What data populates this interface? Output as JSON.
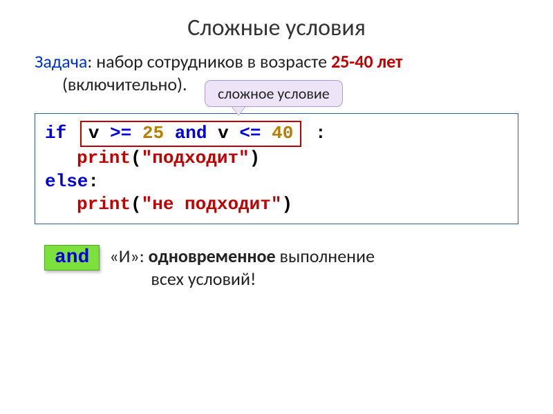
{
  "title": "Сложные условия",
  "task": {
    "label": "Задача",
    "text1": ": набор сотрудников в возрасте ",
    "bold": "25-40 лет",
    "text2": "(включительно)."
  },
  "callout": {
    "text": "сложное условие"
  },
  "code": {
    "if": "if",
    "cond_pre": "v ",
    "ge": ">=",
    "n25": " 25 ",
    "and": "and",
    "cond_mid": " v ",
    "le": "<=",
    "n40": " 40",
    "colon": ":",
    "print": "print",
    "lp": "(",
    "rp": ")",
    "s1": "\"подходит\"",
    "else": "else",
    "s2": "\"не подходит\""
  },
  "and_block": {
    "badge": "and",
    "t1": "«И»: ",
    "bold": "одновременное",
    "t2": " выполнение",
    "t3": "всех условий!"
  }
}
